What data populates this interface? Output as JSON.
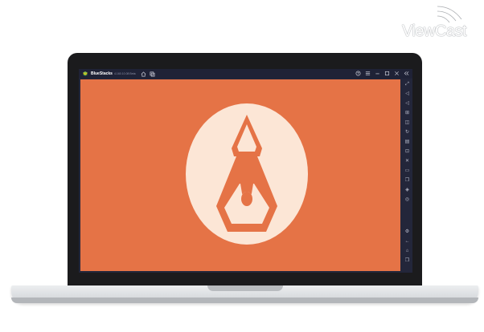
{
  "watermark": {
    "text": "ViewCast"
  },
  "window": {
    "app_name": "BlueStacks",
    "app_version": "4.160.10.08 Beta",
    "titlebar_left_icons": [
      "home-icon",
      "multi-instance-icon"
    ],
    "titlebar_right_icons": [
      "help-icon",
      "menu-icon",
      "minimize-icon",
      "maximize-icon",
      "close-icon",
      "expand-sidebar-icon"
    ]
  },
  "sidebar": {
    "icons": [
      "fullscreen-icon",
      "volume-up-icon",
      "volume-down-icon",
      "keyboard-controls-icon",
      "screenshot-icon",
      "rotate-icon",
      "shake-icon",
      "gamepad-icon",
      "location-icon",
      "folder-icon",
      "copy-icon",
      "layers-icon",
      "eco-mode-icon",
      "settings-icon",
      "back-icon",
      "android-home-icon",
      "recent-apps-icon"
    ]
  },
  "colors": {
    "app_background": "#e57346",
    "logo_circle": "#fce6d6",
    "bezel": "#1b1b1d",
    "emulator_chrome": "#23263a"
  },
  "content": {
    "app_logo": "fountain-pen-nib-icon"
  }
}
